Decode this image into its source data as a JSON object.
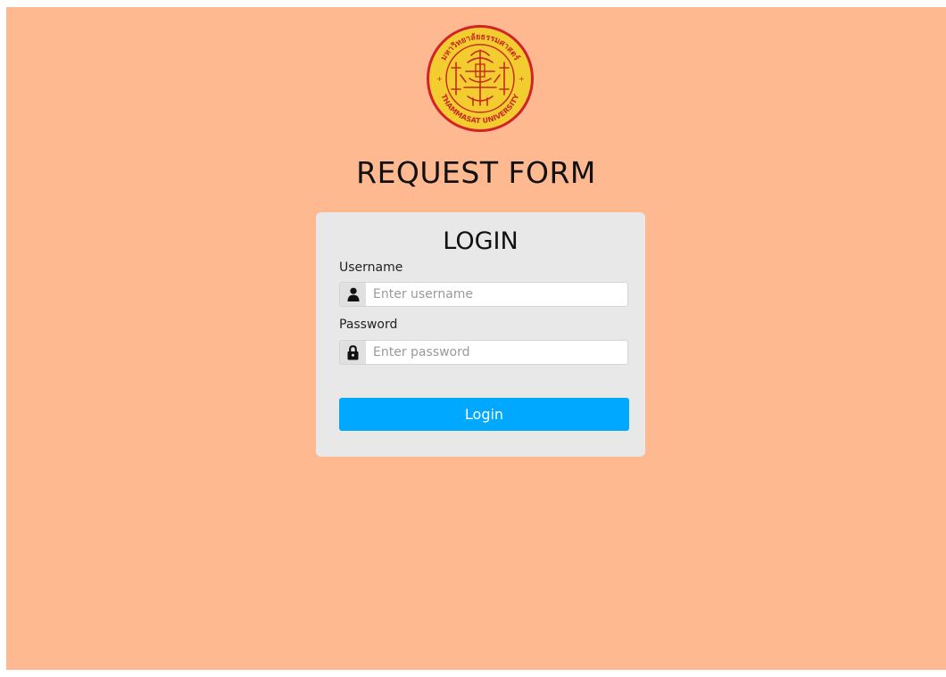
{
  "header": {
    "logo": {
      "thai_text": "มหาวิทยาลัยธรรมศาสตร์",
      "english_text": "THAMMASAT UNIVERSITY"
    },
    "title": "REQUEST FORM"
  },
  "login_card": {
    "title": "LOGIN",
    "username": {
      "label": "Username",
      "placeholder": "Enter username",
      "value": "",
      "icon": "user-icon"
    },
    "password": {
      "label": "Password",
      "placeholder": "Enter password",
      "value": "",
      "icon": "lock-icon"
    },
    "submit_label": "Login"
  },
  "colors": {
    "background": "#ffb991",
    "card": "#e8e8e8",
    "button": "#00a8ff",
    "logo_gold": "#f3cc2f",
    "logo_red": "#d2222a"
  }
}
